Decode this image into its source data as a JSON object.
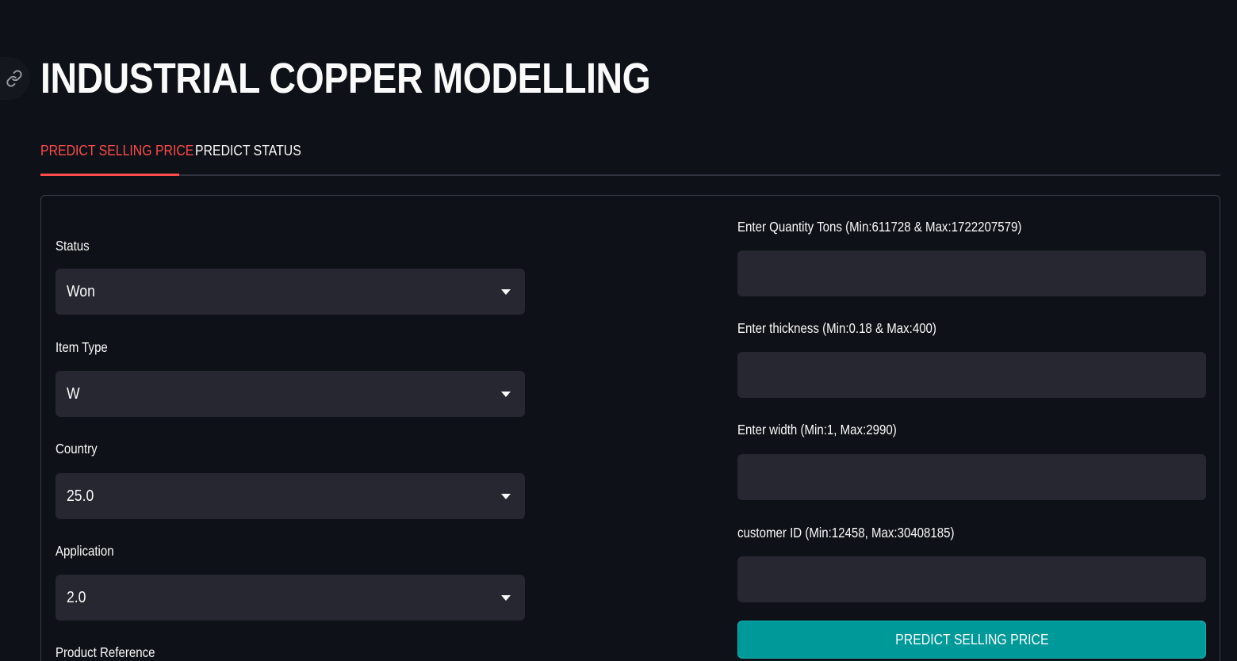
{
  "header": {
    "title": "INDUSTRIAL COPPER MODELLING"
  },
  "tabs": [
    {
      "label": "PREDICT SELLING PRICE",
      "active": true
    },
    {
      "label": "PREDICT STATUS",
      "active": false
    }
  ],
  "form": {
    "status": {
      "label": "Status",
      "value": "Won"
    },
    "item_type": {
      "label": "Item Type",
      "value": "W"
    },
    "country": {
      "label": "Country",
      "value": "25.0"
    },
    "application": {
      "label": "Application",
      "value": "2.0"
    },
    "product_reference": {
      "label": "Product Reference"
    },
    "quantity_tons": {
      "label": "Enter Quantity Tons (Min:611728 & Max:1722207579)",
      "value": ""
    },
    "thickness": {
      "label": "Enter thickness (Min:0.18 & Max:400)",
      "value": ""
    },
    "width": {
      "label": "Enter width (Min:1, Max:2990)",
      "value": ""
    },
    "customer_id": {
      "label": "customer ID (Min:12458, Max:30408185)",
      "value": ""
    },
    "submit_label": "PREDICT SELLING PRICE"
  },
  "colors": {
    "background": "#0e1117",
    "input_bg": "#262730",
    "accent_red": "#ff4b4b",
    "button_teal": "#009999"
  },
  "icons": {
    "anchor": "link-icon",
    "dropdown": "chevron-down-icon"
  }
}
